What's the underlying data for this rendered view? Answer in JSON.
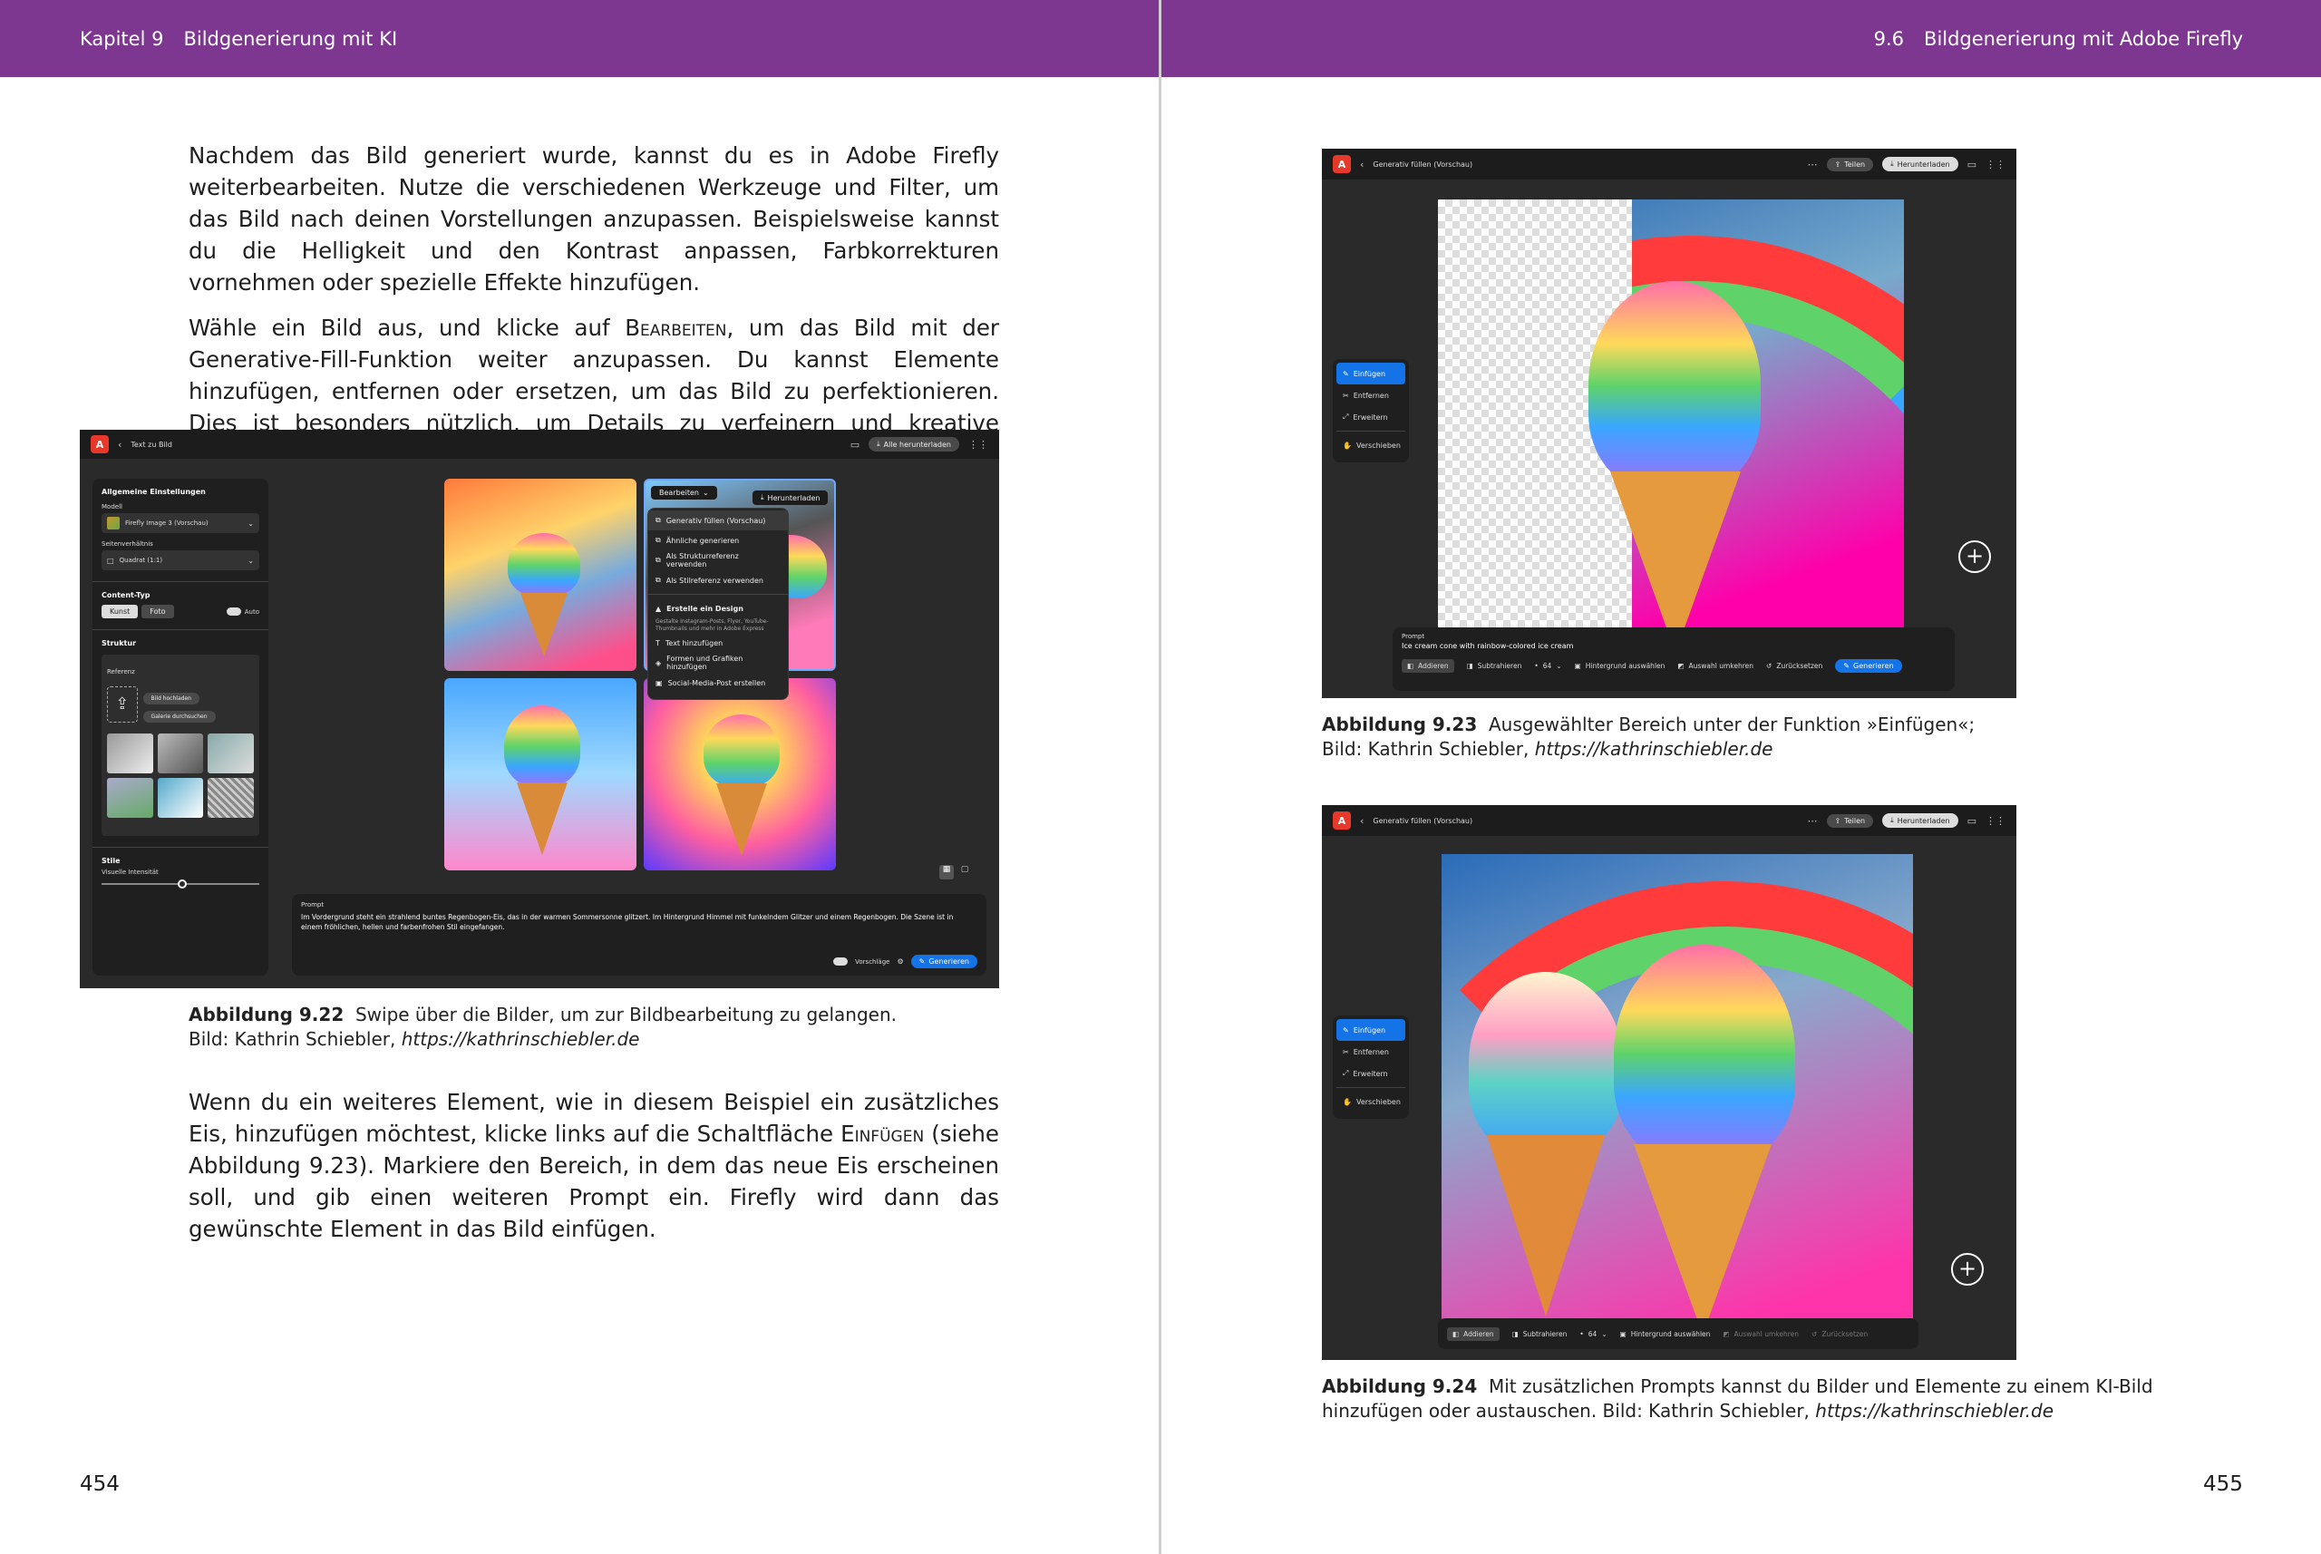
{
  "header_left": {
    "chapter_num": "Kapitel 9",
    "chapter_title": "Bildgenerierung mit KI"
  },
  "header_right": {
    "section_num": "9.6",
    "section_title": "Bildgenerierung mit Adobe Firefly"
  },
  "para1": "Nachdem das Bild generiert wurde, kannst du es in Adobe Firefly weiterbearbeiten. Nutze die verschiedenen Werkzeuge und Filter, um das Bild nach deinen Vorstellungen anzupassen. Beispielsweise kannst du die Helligkeit und den Kontrast anpassen, Farbkorrekturen vornehmen oder spezielle Effekte hinzufügen.",
  "para2_pre": "Wähle ein Bild aus, und klicke auf ",
  "para2_sc": "Bearbeiten",
  "para2_post": ", um das Bild mit der Generative-Fill-Funktion weiter anzupassen. Du kannst Elemente hinzufügen, entfernen oder ersetzen, um das Bild zu perfektionieren. Dies ist besonders nützlich, um Details zu verfeinern und kreative Anpassungen vorzunehmen.",
  "para3_pre": "Wenn du ein weiteres Element, wie in diesem Beispiel ein zusätzliches Eis, hinzufügen möchtest, klicke links auf die Schaltfläche ",
  "para3_sc": "Einfügen",
  "para3_post": " (siehe Abbildung 9.23). Markiere den Bereich, in dem das neue Eis erscheinen soll, und gib einen weiteren Prompt ein. Firefly wird dann das gewünschte Element in das Bild einfügen.",
  "cap22": {
    "label": "Abbildung 9.22",
    "text": "Swipe über die Bilder, um zur Bildbearbeitung zu gelangen.",
    "credit": "Bild: Kathrin Schiebler, ",
    "url": "https://kathrinschiebler.de"
  },
  "cap23": {
    "label": "Abbildung 9.23",
    "text": "Ausgewählter Bereich unter der Funktion »Einfügen«;",
    "credit": "Bild: Kathrin Schiebler, ",
    "url": "https://kathrinschiebler.de"
  },
  "cap24": {
    "label": "Abbildung 9.24",
    "text": "Mit zusätzlichen Prompts kannst du Bilder und Elemente zu einem KI-Bild",
    "text2": "hinzufügen oder austauschen. Bild: Kathrin Schiebler, ",
    "url": "https://kathrinschiebler.de"
  },
  "page_left": "454",
  "page_right": "455",
  "shot1": {
    "title": "Text zu Bild",
    "download_all": "Alle herunterladen",
    "general_settings": "Allgemeine Einstellungen",
    "model_label": "Modell",
    "model_value": "Firefly Image 3 (Vorschau)",
    "aspect_label": "Seitenverhältnis",
    "aspect_value": "Quadrat (1:1)",
    "content_type": "Content-Typ",
    "art": "Kunst",
    "photo": "Foto",
    "auto": "Auto",
    "structure": "Struktur",
    "reference": "Referenz",
    "browse": "Bild hochladen",
    "gallery": "Galerie durchsuchen",
    "styles": "Stile",
    "visual_intensity": "Visuelle Intensität",
    "edit_btn": "Bearbeiten",
    "download_btn": "Herunterladen",
    "menu": [
      "Generativ füllen (Vorschau)",
      "Ähnliche generieren",
      "Als Strukturreferenz verwenden",
      "Als Stilreferenz verwenden"
    ],
    "menu_design": "Erstelle ein Design",
    "menu_design_sub": "Gestalte Instagram-Posts, Flyer, YouTube-Thumbnails und mehr in Adobe Express",
    "menu2": [
      "Text hinzufügen",
      "Formen und Grafiken hinzufügen",
      "Social-Media-Post erstellen"
    ],
    "prompt_label": "Prompt",
    "prompt_text": "Im Vordergrund steht ein strahlend buntes Regenbogen-Eis, das in der warmen Sommersonne glitzert. Im Hintergrund Himmel mit funkelndem Glitzer und einem Regenbogen. Die Szene ist in einem fröhlichen, hellen und farbenfrohen Stil eingefangen.",
    "suggestions": "Vorschläge",
    "generate": "Generieren"
  },
  "shot2": {
    "title": "Generativ füllen (Vorschau)",
    "share": "Teilen",
    "download": "Herunterladen",
    "tools": [
      "Einfügen",
      "Entfernen",
      "Erweitern",
      "Verschieben"
    ],
    "prompt_label": "Prompt",
    "prompt_text": "Ice cream cone with rainbow-colored ice cream",
    "toolbar": [
      "Addieren",
      "Subtrahieren",
      "Hintergrund auswählen",
      "Auswahl umkehren",
      "Zurücksetzen"
    ],
    "brush_size": "64",
    "generate": "Generieren"
  },
  "shot3": {
    "title": "Generativ füllen (Vorschau)",
    "share": "Teilen",
    "download": "Herunterladen",
    "tools": [
      "Einfügen",
      "Entfernen",
      "Erweitern",
      "Verschieben"
    ],
    "toolbar": [
      "Addieren",
      "Subtrahieren",
      "Hintergrund auswählen",
      "Auswahl umkehren",
      "Zurücksetzen"
    ],
    "brush_size": "64"
  }
}
